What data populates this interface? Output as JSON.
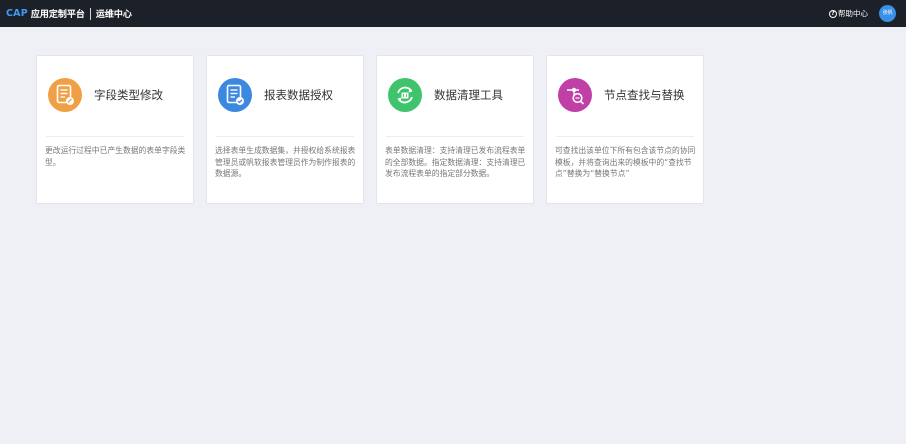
{
  "header": {
    "logo": "CAP",
    "app_name": "应用定制平台",
    "section": "运维中心",
    "help_label": "帮助中心",
    "user_initials": "张帆"
  },
  "colors": {
    "topbar": "#1c2029",
    "background": "#eff0f5",
    "field_type_icon": "#f0a044",
    "report_auth_icon": "#3c88e0",
    "data_clean_icon": "#3fc46d",
    "node_replace_icon": "#c040a8"
  },
  "cards": [
    {
      "title": "字段类型修改",
      "icon": "document-edit-icon",
      "desc": "更改运行过程中已产生数据的表单字段类型。"
    },
    {
      "title": "报表数据授权",
      "icon": "document-check-icon",
      "desc": "选择表单生成数据集，并授权给系统报表管理员或帆软报表管理员作为制作报表的数据源。"
    },
    {
      "title": "数据清理工具",
      "icon": "recycle-icon",
      "desc": "表单数据清理：支持清理已发布流程表单的全部数据。指定数据清理：支持清理已发布流程表单的指定部分数据。"
    },
    {
      "title": "节点查找与替换",
      "icon": "node-search-icon",
      "desc": "可查找出该单位下所有包含该节点的协同模板，并将查询出来的模板中的“查找节点”替换为“替换节点”"
    }
  ]
}
